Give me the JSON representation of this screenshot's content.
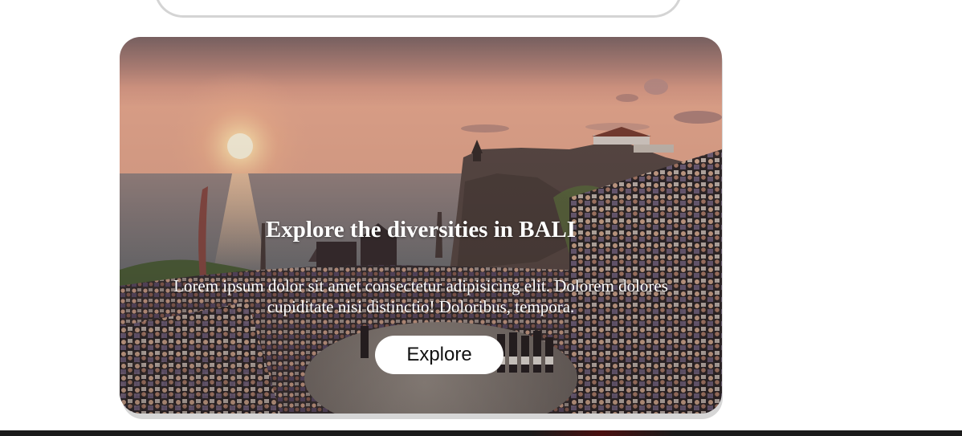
{
  "hero": {
    "title": "Explore the diversities in BALI",
    "text": "Lorem ipsum dolor sit amet consectetur adipisicing elit. Dolorem dolores cupiditate nisi distinctio! Doloribus, tempora.",
    "button_label": "Explore",
    "image": "bali-kecak-dance-sunset-photo"
  },
  "colors": {
    "page_background": "#ffffff",
    "card_border": "#d4d4d4",
    "button_background": "#ffffff",
    "button_text": "#111111",
    "hero_text": "#ffffff",
    "bottom_bar": "#1b1b1b"
  }
}
